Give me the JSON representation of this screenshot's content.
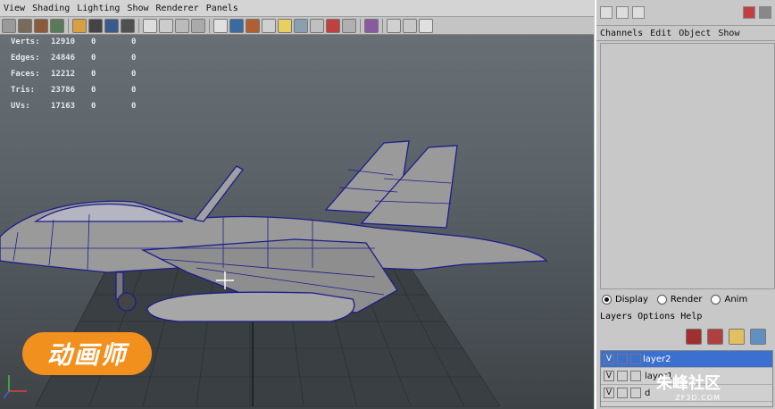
{
  "menubar": {
    "items": [
      "View",
      "Shading",
      "Lighting",
      "Show",
      "Renderer",
      "Panels"
    ]
  },
  "hud": {
    "rows": [
      {
        "label": "Verts:",
        "v1": "12910",
        "v2": "0",
        "v3": "0"
      },
      {
        "label": "Edges:",
        "v1": "24846",
        "v2": "0",
        "v3": "0"
      },
      {
        "label": "Faces:",
        "v1": "12212",
        "v2": "0",
        "v3": "0"
      },
      {
        "label": "Tris:",
        "v1": "23786",
        "v2": "0",
        "v3": "0"
      },
      {
        "label": "UVs:",
        "v1": "17163",
        "v2": "0",
        "v3": "0"
      }
    ]
  },
  "logo": {
    "text": "动画师"
  },
  "channel_box": {
    "menu": [
      "Channels",
      "Edit",
      "Object",
      "Show"
    ]
  },
  "layer_editor": {
    "modes": [
      "Display",
      "Render",
      "Anim"
    ],
    "selected_mode": "Display",
    "menu": [
      "Layers",
      "Options",
      "Help"
    ],
    "layers": [
      {
        "visible": "V",
        "name": "layer2",
        "selected": true
      },
      {
        "visible": "V",
        "name": "layer1",
        "selected": false
      },
      {
        "visible": "V",
        "name": "d",
        "selected": false
      }
    ]
  },
  "watermark": {
    "text": "朱峰社区",
    "sub": "ZF3D.COM"
  },
  "colors": {
    "wire": "#1d1d8c",
    "hull": "#9a9a9a",
    "selection": "#3b6fd0",
    "logo": "#f2901e"
  }
}
